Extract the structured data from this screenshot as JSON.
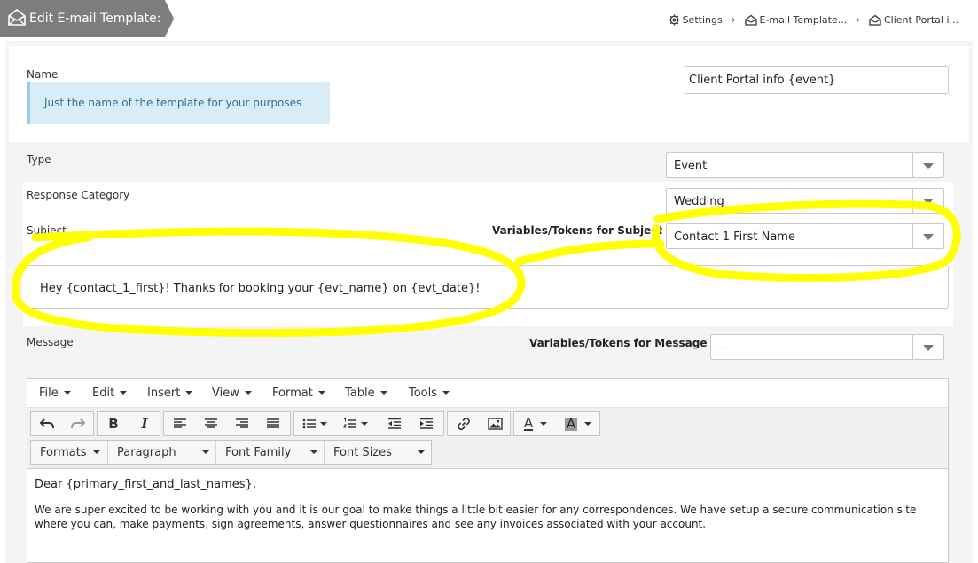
{
  "header": {
    "title": "Edit E-mail Template:",
    "breadcrumbs": [
      {
        "label": "Settings",
        "icon": "gear-icon"
      },
      {
        "label": "E-mail Template...",
        "icon": "envelope-icon"
      },
      {
        "label": "Client Portal i...",
        "icon": "envelope-icon"
      }
    ]
  },
  "form": {
    "name": {
      "label": "Name",
      "help": "Just the name of the template for your purposes",
      "value": "Client Portal info {event}"
    },
    "type": {
      "label": "Type",
      "value": "Event"
    },
    "response_category": {
      "label": "Response Category",
      "value": "Wedding"
    },
    "subject": {
      "label": "Subject",
      "tokens_label": "Variables/Tokens for Subject",
      "tokens_value": "Contact 1 First Name",
      "value": "Hey {contact_1_first}! Thanks for booking your {evt_name} on {evt_date}!"
    },
    "message": {
      "label": "Message",
      "tokens_label": "Variables/Tokens for Message",
      "tokens_value": "--"
    }
  },
  "editor": {
    "menus": [
      "File",
      "Edit",
      "Insert",
      "View",
      "Format",
      "Table",
      "Tools"
    ],
    "dropdowns": [
      "Formats",
      "Paragraph",
      "Font Family",
      "Font Sizes"
    ],
    "toolbar_icons": [
      "undo-icon",
      "redo-icon",
      "bold-icon",
      "italic-icon",
      "align-left-icon",
      "align-center-icon",
      "align-right-icon",
      "align-justify-icon",
      "bullet-list-icon",
      "numbered-list-icon",
      "outdent-icon",
      "indent-icon",
      "link-icon",
      "image-icon",
      "text-color-icon",
      "background-color-icon"
    ],
    "bold_glyph": "B",
    "italic_glyph": "I",
    "color_glyph": "A",
    "content": {
      "greeting": "Dear {primary_first_and_last_names},",
      "paragraph": " We are super excited to be working with you and it is our goal to make things a little bit easier for any correspondences. We have setup a secure communication site where you can, make payments, sign agreements, answer questionnaires and see any invoices associated with your account."
    }
  },
  "annotation": {
    "color": "#ffff00"
  }
}
